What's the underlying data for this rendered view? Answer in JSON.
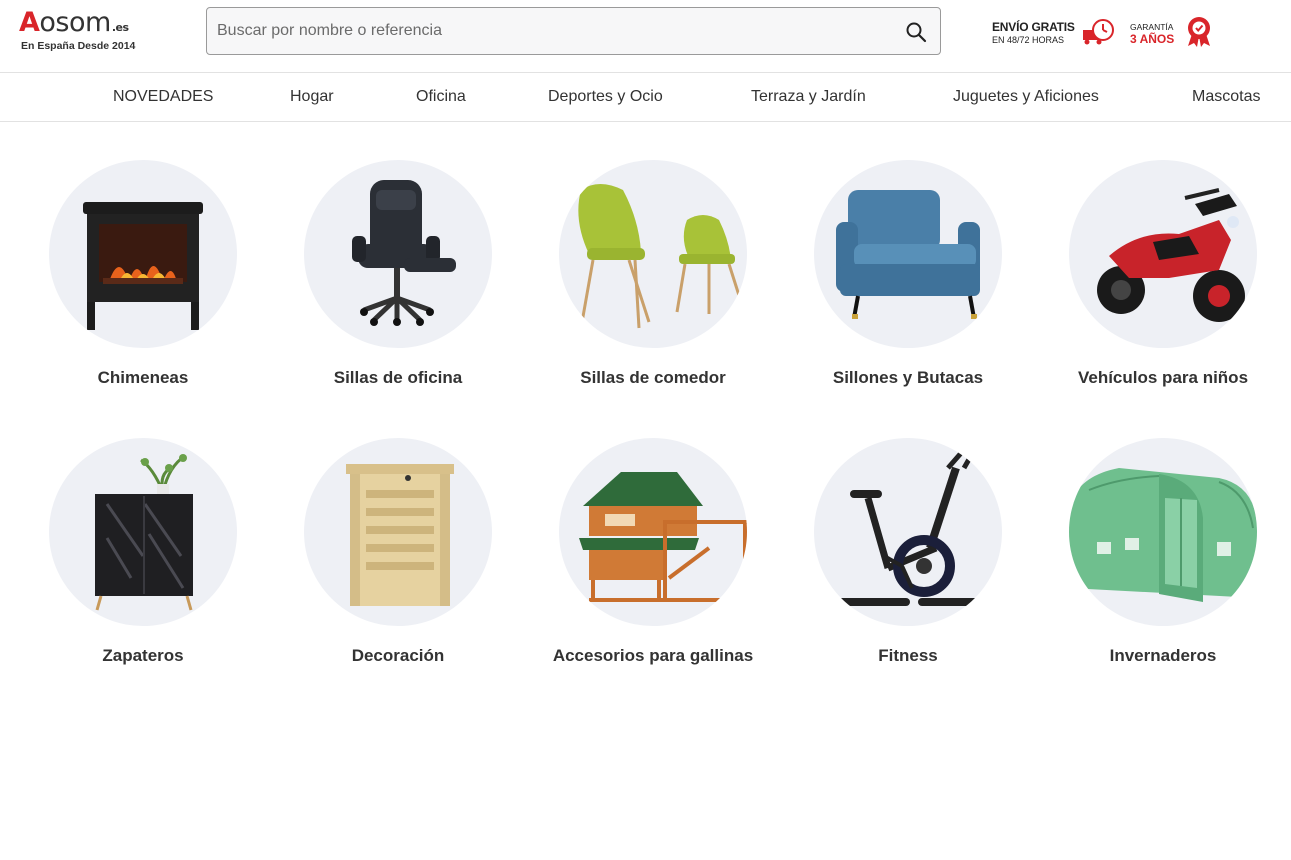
{
  "header": {
    "logo": {
      "brand": "Aosom",
      "suffix": ".es",
      "tagline": "En España Desde 2014"
    },
    "search": {
      "placeholder": "Buscar por nombre o referencia",
      "value": ""
    },
    "shipping": {
      "line1": "ENVÍO GRATIS",
      "line2": "EN 48/72 HORAS"
    },
    "warranty": {
      "line1": "GARANTÍA",
      "line2": "3 AÑOS"
    }
  },
  "nav": {
    "items": [
      {
        "label": "NOVEDADES"
      },
      {
        "label": "Hogar"
      },
      {
        "label": "Oficina"
      },
      {
        "label": "Deportes y Ocio"
      },
      {
        "label": "Terraza y Jardín"
      },
      {
        "label": "Juguetes y Aficiones"
      },
      {
        "label": "Mascotas"
      }
    ]
  },
  "categories": [
    {
      "label": "Chimeneas",
      "icon": "fireplace-icon"
    },
    {
      "label": "Sillas de oficina",
      "icon": "office-chair-icon"
    },
    {
      "label": "Sillas de comedor",
      "icon": "dining-chairs-icon"
    },
    {
      "label": "Sillones y Butacas",
      "icon": "armchair-icon"
    },
    {
      "label": "Vehículos para niños",
      "icon": "kids-motorbike-icon"
    },
    {
      "label": "Zapateros",
      "icon": "shoe-cabinet-icon"
    },
    {
      "label": "Decoración",
      "icon": "radiator-cover-icon"
    },
    {
      "label": "Accesorios para gallinas",
      "icon": "chicken-coop-icon"
    },
    {
      "label": "Fitness",
      "icon": "exercise-bike-icon"
    },
    {
      "label": "Invernaderos",
      "icon": "greenhouse-icon"
    }
  ],
  "colors": {
    "brand_red": "#d9252a",
    "circle_bg": "#eef0f5",
    "text": "#333333"
  }
}
